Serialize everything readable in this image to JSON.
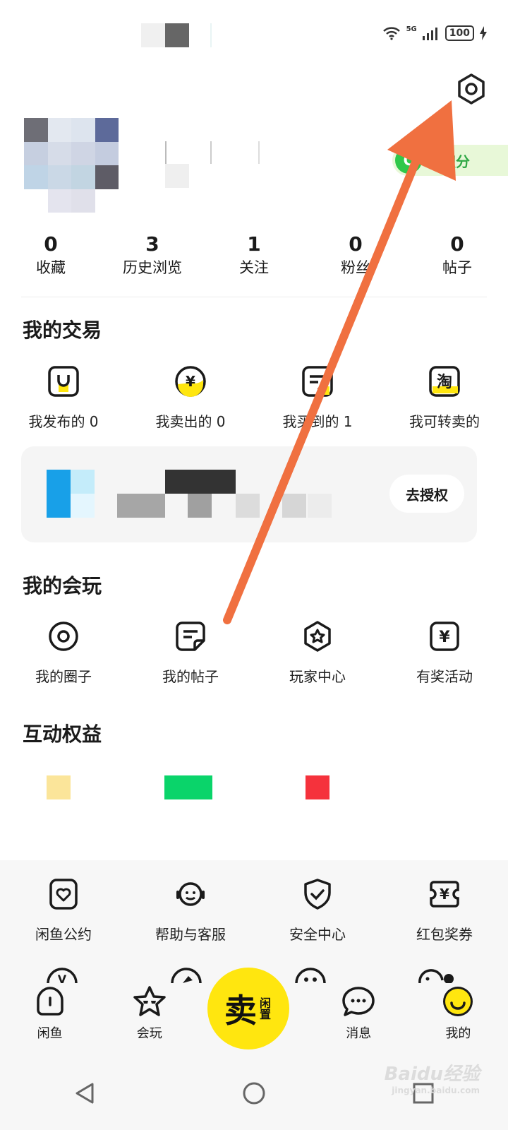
{
  "status_bar": {
    "network": "5G",
    "battery": "100"
  },
  "points_badge": {
    "icon_letter": "C",
    "label": "碳积分"
  },
  "stats": [
    {
      "value": "0",
      "label": "收藏"
    },
    {
      "value": "3",
      "label": "历史浏览"
    },
    {
      "value": "1",
      "label": "关注"
    },
    {
      "value": "0",
      "label": "粉丝"
    },
    {
      "value": "0",
      "label": "帖子"
    }
  ],
  "trade": {
    "title": "我的交易",
    "items": [
      {
        "label": "我发布的 0",
        "icon": "bag-icon"
      },
      {
        "label": "我卖出的 0",
        "icon": "yuan-circle-icon"
      },
      {
        "label": "我买到的 1",
        "icon": "receipt-icon"
      },
      {
        "label": "我可转卖的",
        "icon": "taobao-icon",
        "glyph": "淘"
      }
    ],
    "auth_button": "去授权"
  },
  "play": {
    "title": "我的会玩",
    "items": [
      {
        "label": "我的圈子",
        "icon": "circle-icon"
      },
      {
        "label": "我的帖子",
        "icon": "note-icon"
      },
      {
        "label": "玩家中心",
        "icon": "star-badge-icon"
      },
      {
        "label": "有奖活动",
        "icon": "yuan-card-icon"
      }
    ]
  },
  "rights": {
    "title": "互动权益"
  },
  "services": [
    {
      "label": "闲鱼公约",
      "icon": "heart-doc-icon"
    },
    {
      "label": "帮助与客服",
      "icon": "headset-icon"
    },
    {
      "label": "安全中心",
      "icon": "shield-check-icon"
    },
    {
      "label": "红包奖券",
      "icon": "coupon-icon"
    }
  ],
  "tabbar": [
    {
      "label": "闲鱼",
      "icon": "home-icon"
    },
    {
      "label": "会玩",
      "icon": "star-face-icon"
    },
    {
      "label": "消息",
      "icon": "chat-icon"
    },
    {
      "label": "我的",
      "icon": "smile-icon"
    }
  ],
  "sell_button": {
    "big": "卖",
    "small": "闲置"
  },
  "watermark": {
    "text": "Baidu经验",
    "sub": "jingyan.baidu.com"
  },
  "colors": {
    "accent": "#ffe60f",
    "arrow": "#f07040",
    "points_green": "#2fc84a"
  }
}
